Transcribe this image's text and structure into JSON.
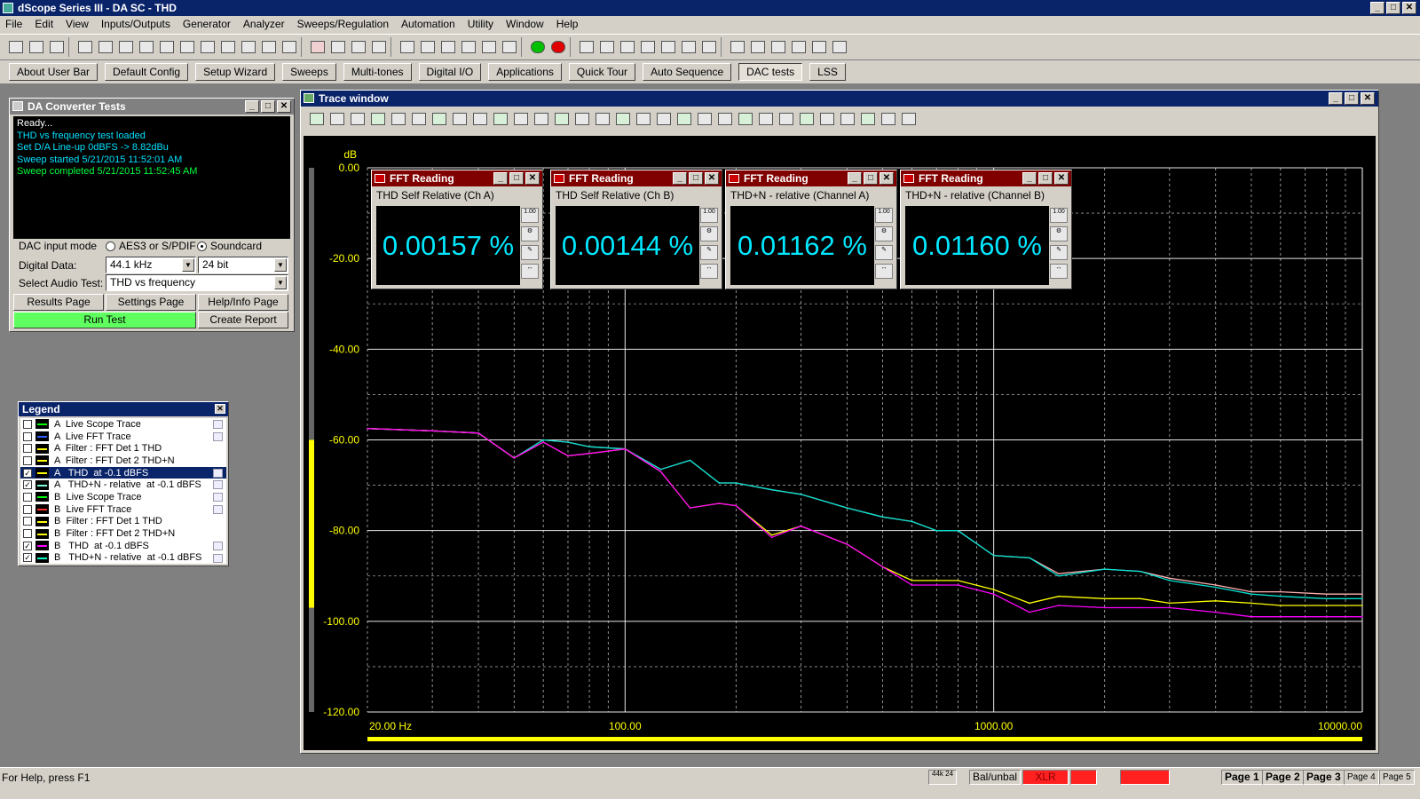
{
  "app": {
    "title": "dScope Series III - DA SC - THD"
  },
  "menu": [
    "File",
    "Edit",
    "View",
    "Inputs/Outputs",
    "Generator",
    "Analyzer",
    "Sweeps/Regulation",
    "Automation",
    "Utility",
    "Window",
    "Help"
  ],
  "toolbar2": [
    "About User Bar",
    "Default Config",
    "Setup Wizard",
    "Sweeps",
    "Multi-tones",
    "Digital I/O",
    "Applications",
    "Quick Tour",
    "Auto Sequence",
    "DAC tests",
    "LSS"
  ],
  "da_panel": {
    "title": "DA Converter Tests",
    "console": [
      "Ready...",
      "THD vs frequency test loaded",
      "Set D/A Line-up 0dBFS -> 8.82dBu",
      "Sweep started 5/21/2015 11:52:01 AM",
      "Sweep completed 5/21/2015 11:52:45 AM"
    ],
    "dac_input_label": "DAC input mode",
    "opt_aes": "AES3 or S/PDIF",
    "opt_sound": "Soundcard",
    "digital_label": "Digital Data:",
    "rate": "44.1 kHz",
    "bits": "24 bit",
    "test_label": "Select Audio Test:",
    "test": "THD vs frequency",
    "btn_results": "Results Page",
    "btn_settings": "Settings Page",
    "btn_help": "Help/Info Page",
    "btn_run": "Run Test",
    "btn_report": "Create Report"
  },
  "legend": {
    "title": "Legend",
    "rows": [
      {
        "text": "A  Live Scope Trace",
        "checked": false,
        "color": "#00ff00"
      },
      {
        "text": "A  Live FFT Trace",
        "checked": false,
        "color": "#3060ff"
      },
      {
        "text": "A  Filter : FFT Det 1 THD",
        "checked": false,
        "color": "#ffff00"
      },
      {
        "text": "A  Filter : FFT Det 2 THD+N",
        "checked": false,
        "color": "#ffff00"
      },
      {
        "text": "A   THD  at -0.1 dBFS",
        "checked": true,
        "color": "#ffff00"
      },
      {
        "text": "A   THD+N - relative  at -0.1 dBFS",
        "checked": true,
        "color": "#80ffe0"
      },
      {
        "text": "B  Live Scope Trace",
        "checked": false,
        "color": "#00ff00"
      },
      {
        "text": "B  Live FFT Trace",
        "checked": false,
        "color": "#ff3030"
      },
      {
        "text": "B  Filter : FFT Det 1 THD",
        "checked": false,
        "color": "#ffff00"
      },
      {
        "text": "B  Filter : FFT Det 2 THD+N",
        "checked": false,
        "color": "#ffff00"
      },
      {
        "text": "B   THD  at -0.1 dBFS",
        "checked": true,
        "color": "#ff00ff"
      },
      {
        "text": "B   THD+N - relative  at -0.1 dBFS",
        "checked": true,
        "color": "#00ffcc"
      }
    ],
    "selected": 4
  },
  "trace": {
    "title": "Trace window"
  },
  "fft": [
    {
      "title": "FFT Reading",
      "label": "THD Self Relative (Ch A)",
      "value": "0.00157 %"
    },
    {
      "title": "FFT Reading",
      "label": "THD Self Relative (Ch B)",
      "value": "0.00144 %"
    },
    {
      "title": "FFT Reading",
      "label": "THD+N - relative (Channel A)",
      "value": "0.01162 %"
    },
    {
      "title": "FFT Reading",
      "label": "THD+N - relative (Channel B)",
      "value": "0.01160 %"
    }
  ],
  "chart_data": {
    "type": "line",
    "ylabel": "dB",
    "yticks": [
      "0.00",
      "-20.00",
      "-40.00",
      "-60.00",
      "-80.00",
      "-100.00",
      "-120.00"
    ],
    "xticks": [
      "20.00 Hz",
      "100.00",
      "1000.00",
      "10000.00"
    ],
    "ylim": [
      -120,
      0
    ],
    "xlim": [
      20,
      10000
    ],
    "xscale": "log",
    "x": [
      20,
      30,
      40,
      50,
      60,
      70,
      80,
      100,
      125,
      150,
      180,
      200,
      250,
      300,
      400,
      500,
      600,
      700,
      800,
      1000,
      1250,
      1500,
      2000,
      2500,
      3000,
      4000,
      5000,
      6000,
      8000,
      10000
    ],
    "series": [
      {
        "name": "A THD at -0.1 dBFS",
        "color": "#ffff00",
        "values": [
          -57.5,
          -58,
          -58.5,
          -64,
          -60.5,
          -63.5,
          -63,
          -62,
          -67,
          -75,
          -74,
          -74.5,
          -81,
          -79,
          -83,
          -88,
          -91,
          -91,
          -91,
          -93,
          -96,
          -94.5,
          -95,
          -95,
          -96,
          -95.5,
          -96,
          -96.5,
          -96.5,
          -96.5
        ]
      },
      {
        "name": "A THD+N - relative at -0.1 dBFS",
        "color": "#ffb0b0",
        "values": [
          -57.5,
          -58,
          -58.5,
          -64,
          -60,
          -60.5,
          -61.5,
          -62,
          -66.5,
          -64.5,
          -69.5,
          -69.5,
          -71,
          -72,
          -75,
          -77,
          -78,
          -80,
          -80,
          -85.5,
          -86,
          -89.5,
          -88.5,
          -89,
          -90.5,
          -92,
          -93.5,
          -93.5,
          -94,
          -94
        ]
      },
      {
        "name": "B THD at -0.1 dBFS",
        "color": "#ff00ff",
        "values": [
          -57.5,
          -58,
          -58.5,
          -64,
          -60.5,
          -63.5,
          -63,
          -62,
          -67,
          -75,
          -74,
          -74.5,
          -81.5,
          -79,
          -83,
          -88,
          -92,
          -92,
          -92,
          -94,
          -98,
          -96.5,
          -97,
          -97,
          -97,
          -98,
          -99,
          -99,
          -99,
          -99
        ]
      },
      {
        "name": "B THD+N - relative at -0.1 dBFS",
        "color": "#00e0d0",
        "values": [
          -57.5,
          -58,
          -58.5,
          -64,
          -60,
          -60.5,
          -61.5,
          -62,
          -66.5,
          -64.5,
          -69.5,
          -69.5,
          -71,
          -72,
          -75,
          -77,
          -78,
          -80,
          -80,
          -85.5,
          -86,
          -90,
          -88.5,
          -89,
          -91,
          -92.5,
          -94,
          -94.5,
          -95,
          -95
        ]
      }
    ]
  },
  "status": {
    "help": "For Help, press F1",
    "rate": "44k 24",
    "balun": "Bal/unbal",
    "xlr": "XLR",
    "pages": [
      "Page 1",
      "Page 2",
      "Page 3",
      "Page 4",
      "Page 5"
    ]
  }
}
